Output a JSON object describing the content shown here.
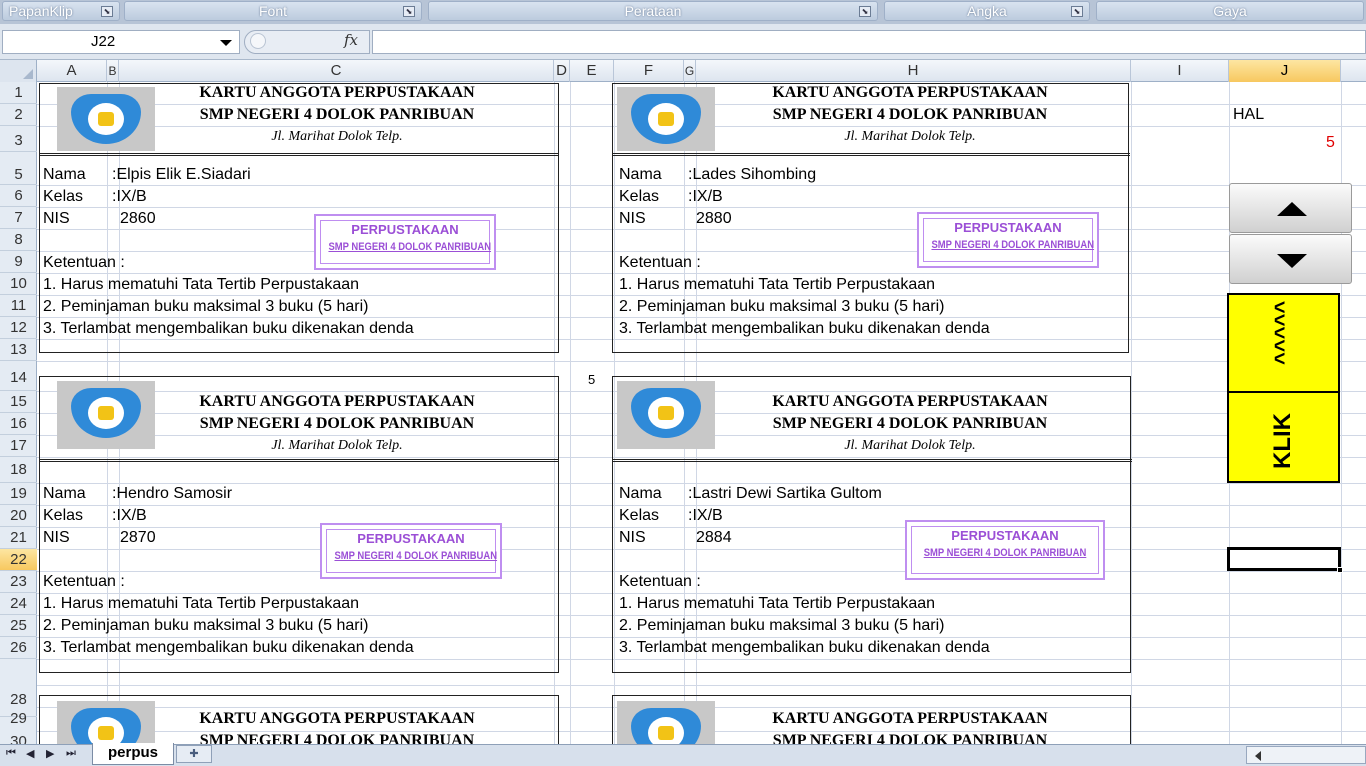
{
  "ribbon": {
    "groups": [
      {
        "label": "PapanKlip"
      },
      {
        "label": "Font"
      },
      {
        "label": "Perataan"
      },
      {
        "label": "Angka"
      },
      {
        "label": "Gaya"
      }
    ]
  },
  "formula_bar": {
    "name_box": "J22",
    "fx": "fx",
    "formula": ""
  },
  "columns": [
    "A",
    "B",
    "C",
    "D",
    "E",
    "F",
    "G",
    "H",
    "I",
    "J"
  ],
  "rows": [
    "1",
    "2",
    "3",
    "5",
    "6",
    "7",
    "8",
    "9",
    "10",
    "11",
    "12",
    "13",
    "14",
    "15",
    "16",
    "17",
    "18",
    "19",
    "20",
    "21",
    "22",
    "23",
    "24",
    "25",
    "26",
    "28",
    "29",
    "30"
  ],
  "card_template": {
    "title": "KARTU ANGGOTA PERPUSTAKAAN",
    "school": "SMP NEGERI 4 DOLOK PANRIBUAN",
    "address": "Jl. Marihat Dolok Telp.",
    "lbl_nama": "Nama",
    "lbl_kelas": "Kelas",
    "lbl_nis": "NIS",
    "ketentuan": "Ketentuan :",
    "rule1": "1. Harus mematuhi Tata Tertib Perpustakaan",
    "rule2": "2. Peminjaman buku maksimal 3 buku (5 hari)",
    "rule3": "3. Terlambat mengembalikan buku dikenakan denda",
    "stamp_line1": "PERPUSTAKAAN",
    "stamp_line2": "SMP NEGERI 4 DOLOK PANRIBUAN"
  },
  "cards": [
    {
      "nama": ":Elpis Elik E.Siadari",
      "kelas": ":IX/B",
      "nis": "2860"
    },
    {
      "nama": ":Lades Sihombing",
      "kelas": ":IX/B",
      "nis": "2880"
    },
    {
      "nama": ":Hendro Samosir",
      "kelas": ":IX/B",
      "nis": "2870"
    },
    {
      "nama": ":Lastri Dewi Sartika Gultom",
      "kelas": ":IX/B",
      "nis": "2884"
    }
  ],
  "e14_value": "5",
  "panel": {
    "hal_label": "HAL",
    "hal_value": "5",
    "klik_arrows": "^^^^^",
    "klik_label": "KLIK"
  },
  "sheet_tabs": {
    "active": "perpus"
  },
  "colors": {
    "hal_value": "#e00000",
    "klik_bg": "#ffff00",
    "stamp": "#9b4fd6",
    "selected_header": "#f7c85f"
  }
}
